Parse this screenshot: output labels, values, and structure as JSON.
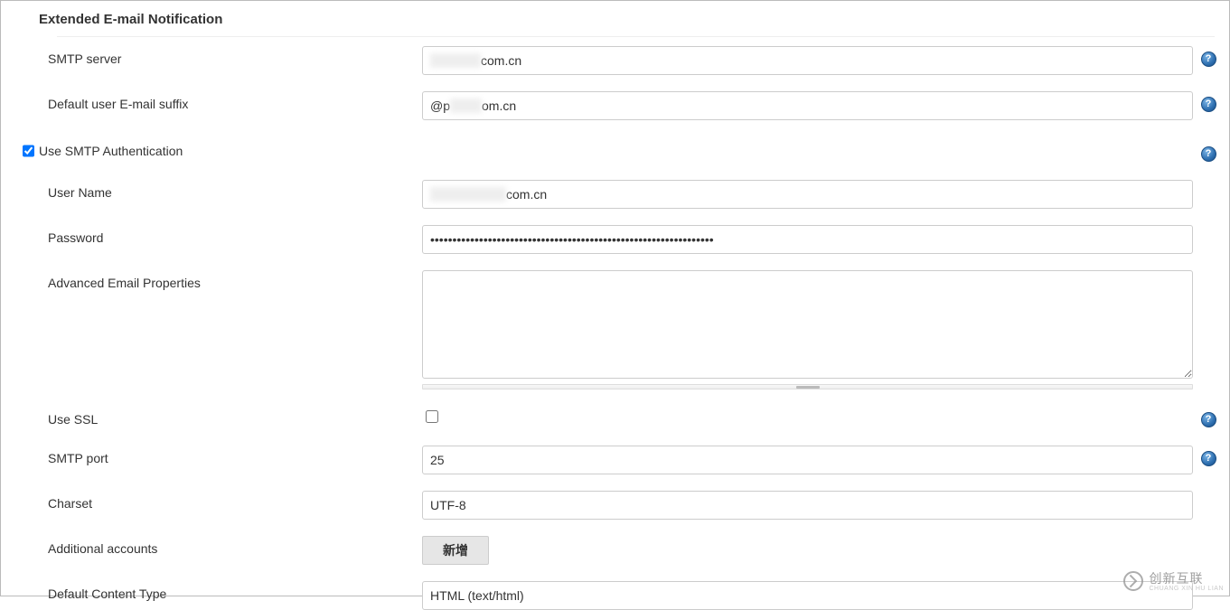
{
  "section": {
    "title": "Extended E-mail Notification"
  },
  "fields": {
    "smtp_server": {
      "label": "SMTP server",
      "value_prefix_masked": "xxxxxxxx",
      "value_suffix": "com.cn"
    },
    "default_suffix": {
      "label": "Default user E-mail suffix",
      "value_prefix": "@p",
      "value_mid_masked": "xxxxx",
      "value_suffix": "om.cn"
    },
    "use_smtp_auth": {
      "label": "Use SMTP Authentication",
      "checked": true
    },
    "user_name": {
      "label": "User Name",
      "value_prefix_masked": "xxxxxxxxxxxx",
      "value_suffix": "com.cn"
    },
    "password": {
      "label": "Password",
      "value": "••••••••••••••••••••••••••••••••••••••••••••••••••••••••••••••••"
    },
    "advanced_props": {
      "label": "Advanced Email Properties",
      "value": ""
    },
    "use_ssl": {
      "label": "Use SSL",
      "checked": false
    },
    "smtp_port": {
      "label": "SMTP port",
      "value": "25"
    },
    "charset": {
      "label": "Charset",
      "value": "UTF-8"
    },
    "additional_accounts": {
      "label": "Additional accounts",
      "button": "新增"
    },
    "default_content_type": {
      "label": "Default Content Type",
      "value": "HTML (text/html)"
    }
  },
  "watermark": {
    "text": "创新互联",
    "sub": "CHUANG XIN HU LIAN"
  }
}
